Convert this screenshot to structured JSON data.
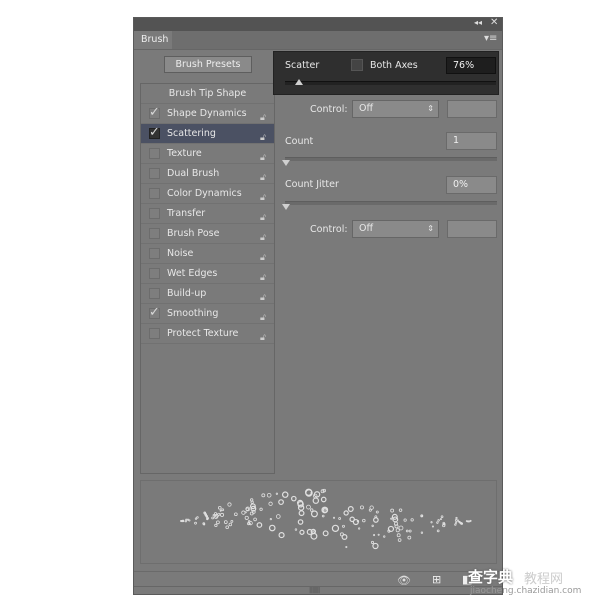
{
  "window": {
    "collapse_icon": "double-chevron-left-icon",
    "close_icon": "close-icon"
  },
  "tab": {
    "label": "Brush",
    "menu_icon": "panel-menu-icon"
  },
  "presets_button": "Brush Presets",
  "brush_tip_shape": "Brush Tip Shape",
  "options": [
    {
      "label": "Shape Dynamics",
      "checked": true,
      "selected": false
    },
    {
      "label": "Scattering",
      "checked": true,
      "selected": true
    },
    {
      "label": "Texture",
      "checked": false,
      "selected": false
    },
    {
      "label": "Dual Brush",
      "checked": false,
      "selected": false
    },
    {
      "label": "Color Dynamics",
      "checked": false,
      "selected": false
    },
    {
      "label": "Transfer",
      "checked": false,
      "selected": false
    },
    {
      "label": "Brush Pose",
      "checked": false,
      "selected": false
    },
    {
      "label": "Noise",
      "checked": false,
      "selected": false
    },
    {
      "label": "Wet Edges",
      "checked": false,
      "selected": false
    },
    {
      "label": "Build-up",
      "checked": false,
      "selected": false
    },
    {
      "label": "Smoothing",
      "checked": true,
      "selected": false
    },
    {
      "label": "Protect Texture",
      "checked": false,
      "selected": false
    }
  ],
  "scatter": {
    "label": "Scatter",
    "both_axes_label": "Both Axes",
    "both_axes_checked": false,
    "value": "76%",
    "slider_percent": 3,
    "control_label": "Control:",
    "control_value": "Off"
  },
  "count": {
    "label": "Count",
    "value": "1",
    "slider_percent": 0
  },
  "count_jitter": {
    "label": "Count Jitter",
    "value": "0%",
    "slider_percent": 0,
    "control_label": "Control:",
    "control_value": "Off"
  },
  "watermark": {
    "text": "查字典",
    "text2": "教程网",
    "url": "jiaocheng.chazidian.com"
  }
}
